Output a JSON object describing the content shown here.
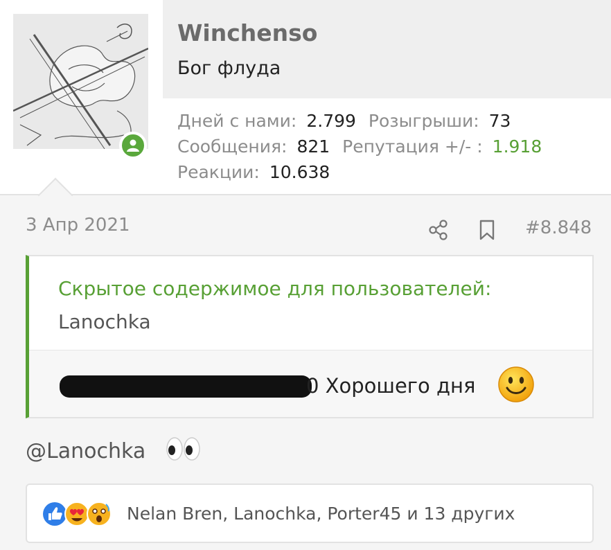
{
  "user": {
    "name": "Winchenso",
    "title": "Бог флуда",
    "stats": {
      "days_label": "Дней с нами:",
      "days_value": "2.799",
      "giveaways_label": "Розыгрыши:",
      "giveaways_value": "73",
      "messages_label": "Сообщения:",
      "messages_value": "821",
      "reputation_label": "Репутация +/- :",
      "reputation_value": "1.918",
      "reactions_label": "Реакции:",
      "reactions_value": "10.638"
    }
  },
  "post": {
    "date": "3 Апр 2021",
    "number": "#8.848",
    "spoiler": {
      "title": "Скрытое содержимое для пользователей:",
      "user": "Lanochka",
      "text": "0 Хорошего дня"
    },
    "mention": "@Lanochka",
    "reactions_text": "Nelan Bren, Lanochka, Porter45 и 13 других"
  },
  "icons": {
    "online": "user-online-icon",
    "share": "share-icon",
    "bookmark": "bookmark-icon",
    "smile": "smile-emoji-icon",
    "eyes": "eyes-emoji-icon",
    "like": "like-reaction-icon",
    "love": "love-reaction-icon",
    "wow": "wow-reaction-icon"
  },
  "colors": {
    "accent_green": "#58a035",
    "muted_text": "#8c8c8c",
    "background": "#f5f5f5"
  }
}
